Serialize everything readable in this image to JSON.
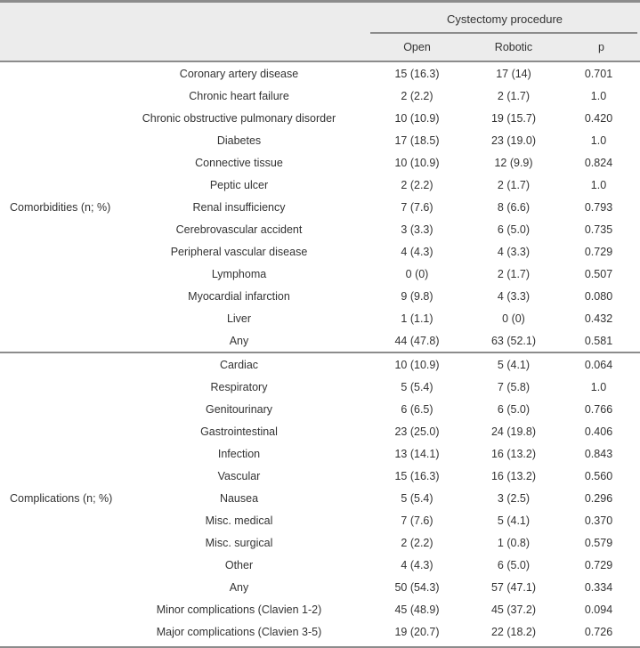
{
  "table": {
    "header": {
      "group_header": "Cystectomy procedure",
      "columns": [
        "Open",
        "Robotic",
        "p"
      ],
      "stub_header": ""
    },
    "sections": [
      {
        "name": "Comorbidities (n; %)",
        "rows": [
          {
            "label": "Coronary artery disease",
            "open": "15 (16.3)",
            "robotic": "17 (14)",
            "p": "0.701"
          },
          {
            "label": "Chronic heart failure",
            "open": "2 (2.2)",
            "robotic": "2 (1.7)",
            "p": "1.0"
          },
          {
            "label": "Chronic obstructive pulmonary disorder",
            "open": "10 (10.9)",
            "robotic": "19 (15.7)",
            "p": "0.420"
          },
          {
            "label": "Diabetes",
            "open": "17 (18.5)",
            "robotic": "23 (19.0)",
            "p": "1.0"
          },
          {
            "label": "Connective tissue",
            "open": "10 (10.9)",
            "robotic": "12 (9.9)",
            "p": "0.824"
          },
          {
            "label": "Peptic ulcer",
            "open": "2 (2.2)",
            "robotic": "2 (1.7)",
            "p": "1.0"
          },
          {
            "label": "Renal insufficiency",
            "open": "7 (7.6)",
            "robotic": "8 (6.6)",
            "p": "0.793"
          },
          {
            "label": "Cerebrovascular accident",
            "open": "3 (3.3)",
            "robotic": "6 (5.0)",
            "p": "0.735"
          },
          {
            "label": "Peripheral vascular disease",
            "open": "4 (4.3)",
            "robotic": "4 (3.3)",
            "p": "0.729"
          },
          {
            "label": "Lymphoma",
            "open": "0 (0)",
            "robotic": "2 (1.7)",
            "p": "0.507"
          },
          {
            "label": "Myocardial infarction",
            "open": "9 (9.8)",
            "robotic": "4 (3.3)",
            "p": "0.080"
          },
          {
            "label": "Liver",
            "open": "1 (1.1)",
            "robotic": "0 (0)",
            "p": "0.432"
          },
          {
            "label": "Any",
            "open": "44 (47.8)",
            "robotic": "63 (52.1)",
            "p": "0.581"
          }
        ]
      },
      {
        "name": "Complications (n; %)",
        "rows": [
          {
            "label": "Cardiac",
            "open": "10 (10.9)",
            "robotic": "5 (4.1)",
            "p": "0.064"
          },
          {
            "label": "Respiratory",
            "open": "5 (5.4)",
            "robotic": "7 (5.8)",
            "p": "1.0"
          },
          {
            "label": "Genitourinary",
            "open": "6 (6.5)",
            "robotic": "6 (5.0)",
            "p": "0.766"
          },
          {
            "label": "Gastrointestinal",
            "open": "23 (25.0)",
            "robotic": "24 (19.8)",
            "p": "0.406"
          },
          {
            "label": "Infection",
            "open": "13 (14.1)",
            "robotic": "16 (13.2)",
            "p": "0.843"
          },
          {
            "label": "Vascular",
            "open": "15 (16.3)",
            "robotic": "16 (13.2)",
            "p": "0.560"
          },
          {
            "label": "Nausea",
            "open": "5 (5.4)",
            "robotic": "3 (2.5)",
            "p": "0.296"
          },
          {
            "label": "Misc. medical",
            "open": "7 (7.6)",
            "robotic": "5 (4.1)",
            "p": "0.370"
          },
          {
            "label": "Misc. surgical",
            "open": "2 (2.2)",
            "robotic": "1 (0.8)",
            "p": "0.579"
          },
          {
            "label": "Other",
            "open": "4 (4.3)",
            "robotic": "6 (5.0)",
            "p": "0.729"
          },
          {
            "label": "Any",
            "open": "50 (54.3)",
            "robotic": "57 (47.1)",
            "p": "0.334"
          },
          {
            "label": "Minor complications (Clavien 1-2)",
            "open": "45 (48.9)",
            "robotic": "45 (37.2)",
            "p": "0.094"
          },
          {
            "label": "Major complications (Clavien 3-5)",
            "open": "19 (20.7)",
            "robotic": "22 (18.2)",
            "p": "0.726"
          }
        ]
      }
    ]
  },
  "colors": {
    "header_background": "#ececec",
    "rule": "#8c8c8c",
    "text": "#333333",
    "page_background": "#ffffff"
  }
}
